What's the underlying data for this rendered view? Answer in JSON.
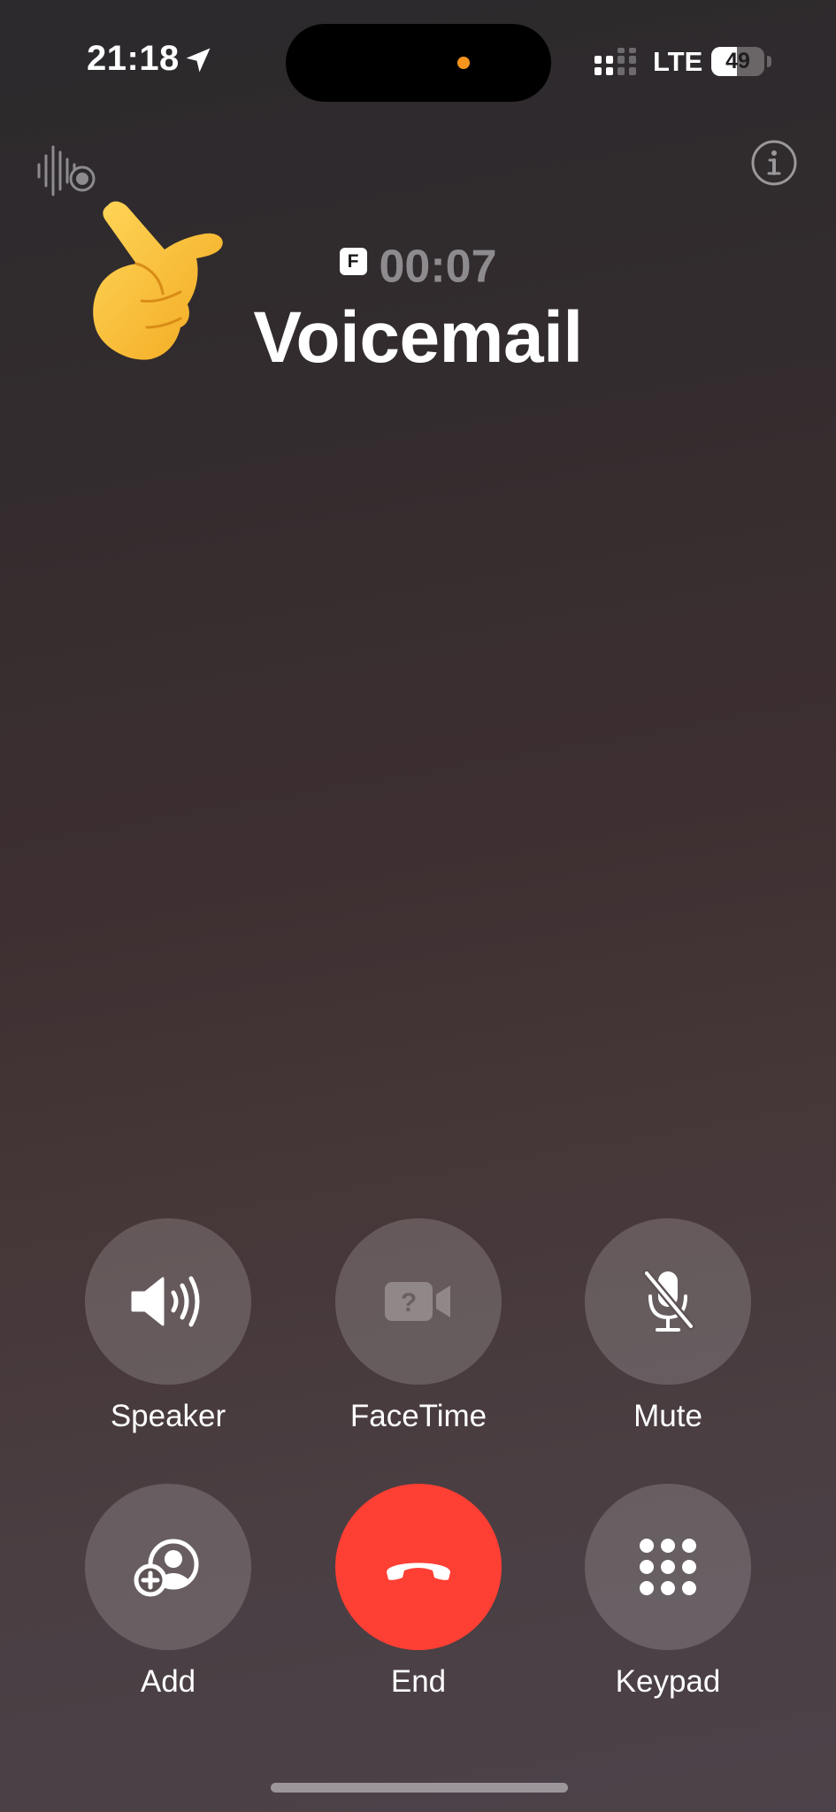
{
  "status_bar": {
    "time": "21:18",
    "location_icon": "location-arrow-icon",
    "network": "LTE",
    "battery_percent": 49,
    "battery_label": "49"
  },
  "call": {
    "badge": "F",
    "timer": "00:07",
    "name": "Voicemail"
  },
  "top_actions": {
    "left_icon": "live-voicemail-waveform-icon",
    "right_icon": "info-icon"
  },
  "overlay": {
    "icon": "pointing-hand-emoji"
  },
  "controls": [
    {
      "label": "Speaker",
      "icon": "speaker-wave-icon"
    },
    {
      "label": "FaceTime",
      "icon": "facetime-video-icon"
    },
    {
      "label": "Mute",
      "icon": "mic-slash-icon"
    },
    {
      "label": "Add",
      "icon": "add-person-icon"
    },
    {
      "label": "End",
      "icon": "phone-hangup-icon"
    },
    {
      "label": "Keypad",
      "icon": "keypad-icon"
    }
  ],
  "colors": {
    "end_call": "#fe3f34",
    "dynamic_island_dot": "#f7941d"
  }
}
